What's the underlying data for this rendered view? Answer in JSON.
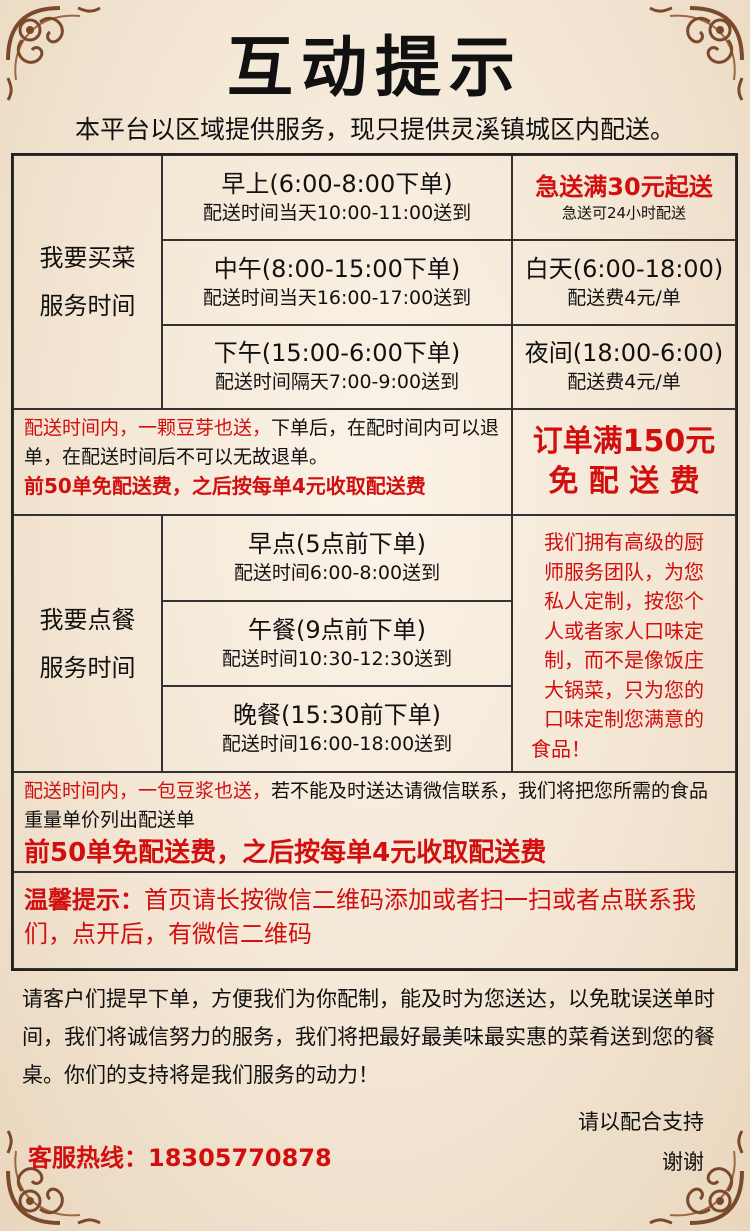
{
  "title": "互动提示",
  "subtitle": "本平台以区域提供服务，现只提供灵溪镇城区内配送。",
  "veg": {
    "label_line1": "我要买菜",
    "label_line2": "服务时间",
    "slots": [
      {
        "title": "早上(6:00-8:00下单)",
        "detail": "配送时间当天10:00-11:00送到"
      },
      {
        "title": "中午(8:00-15:00下单)",
        "detail": "配送时间当天16:00-17:00送到"
      },
      {
        "title": "下午(15:00-6:00下单)",
        "detail": "配送时间隔天7:00-9:00送到"
      }
    ],
    "express_title": "急送满30元起送",
    "express_note": "急送可24小时配送",
    "day_title": "白天(6:00-18:00)",
    "day_fee": "配送费4元/单",
    "night_title": "夜间(18:00-6:00)",
    "night_fee": "配送费4元/单"
  },
  "veg_notice": {
    "red_part": "配送时间内，一颗豆芽也送，",
    "black_part": "下单后，在配时间内可以退单，在配送时间后不可以无故退单。",
    "bold_line": "前50单免配送费，之后按每单4元收取配送费"
  },
  "free_shipping": {
    "line1": "订单满150元",
    "line2": "免 配 送 费"
  },
  "meal": {
    "label_line1": "我要点餐",
    "label_line2": "服务时间",
    "slots": [
      {
        "title": "早点(5点前下单)",
        "detail": "配送时间6:00-8:00送到"
      },
      {
        "title": "午餐(9点前下单)",
        "detail": "配送时间10:30-12:30送到"
      },
      {
        "title": "晚餐(15:30前下单)",
        "detail": "配送时间16:00-18:00送到"
      }
    ],
    "chef_lines": [
      "我们拥有高级的厨",
      "师服务团队，为您",
      "私人定制，按您个",
      "人或者家人口味定",
      "制，而不是像饭庄",
      "大锅菜，只为您的",
      "口味定制您满意的",
      "食品！"
    ]
  },
  "meal_notice": {
    "red_part": "配送时间内，一包豆浆也送，",
    "black_part": "若不能及时送达请微信联系，我们将把您所需的食品重量单价列出配送单",
    "bold_line": "前50单免配送费，之后按每单4元收取配送费"
  },
  "tip": {
    "label": "温馨提示：",
    "text": "首页请长按微信二维码添加或者扫一扫或者点联系我们，点开后，有微信二维码"
  },
  "closing": "请客户们提早下单，方便我们为你配制，能及时为您送达，以免耽误送单时间，我们将诚信努力的服务，我们将把最好最美味最实惠的菜肴送到您的餐桌。你们的支持将是我们服务的动力！",
  "sign_line1": "请以配合支持",
  "sign_line2": "谢谢",
  "hotline": "客服热线：18305770878",
  "colors": {
    "accent_red": "#d20f0f",
    "ornament": "#7a4a2a"
  }
}
